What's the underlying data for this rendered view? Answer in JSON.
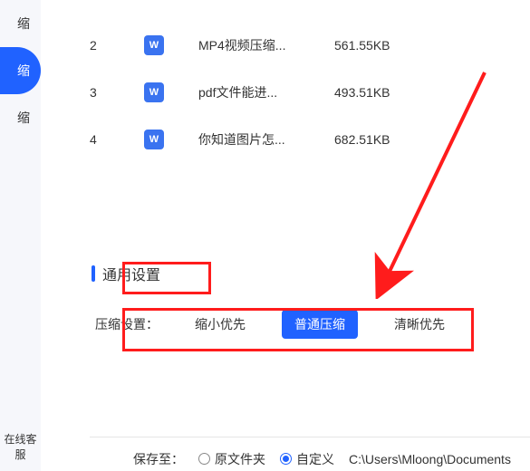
{
  "sidebar": {
    "items": [
      {
        "label": "缩",
        "active": false
      },
      {
        "label": "缩",
        "active": true
      },
      {
        "label": "缩",
        "active": false
      }
    ],
    "footer_label": "在线客服"
  },
  "filelist": {
    "rows": [
      {
        "idx": "2",
        "name": "MP4视频压缩...",
        "size": "561.55KB"
      },
      {
        "idx": "3",
        "name": "pdf文件能进...",
        "size": "493.51KB"
      },
      {
        "idx": "4",
        "name": "你知道图片怎...",
        "size": "682.51KB"
      }
    ],
    "icon_glyph": "W"
  },
  "settings": {
    "section_title": "通用设置",
    "key_label": "压缩设置：",
    "options": [
      {
        "label": "缩小优先",
        "active": false
      },
      {
        "label": "普通压缩",
        "active": true
      },
      {
        "label": "清晰优先",
        "active": false
      }
    ]
  },
  "footer": {
    "save_to_label": "保存至：",
    "orig_folder_label": "原文件夹",
    "custom_label": "自定义",
    "custom_selected": true,
    "path_value": "C:\\Users\\Mloong\\Documents"
  }
}
